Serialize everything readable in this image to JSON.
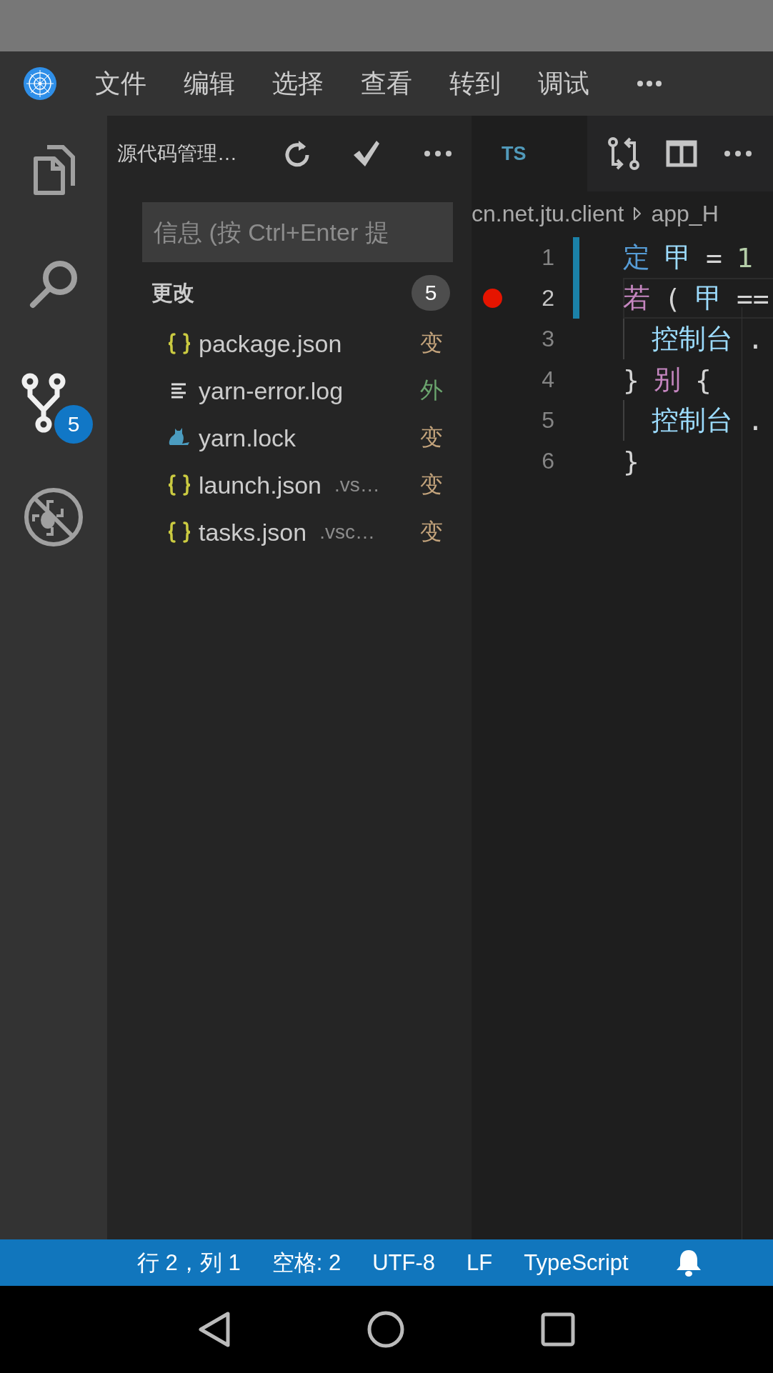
{
  "menu": {
    "items": [
      "文件",
      "编辑",
      "选择",
      "查看",
      "转到",
      "调试"
    ]
  },
  "activity_bar": [
    {
      "kind": "files",
      "selected": false
    },
    {
      "kind": "search",
      "selected": false
    },
    {
      "kind": "scm",
      "selected": true,
      "badge": "5"
    },
    {
      "kind": "debug",
      "selected": false
    }
  ],
  "sidebar": {
    "title": "源代码管理…",
    "message_input": {
      "placeholder": "信息 (按 Ctrl+Enter 提"
    },
    "changes": {
      "label": "更改",
      "count": "5",
      "files": [
        {
          "name": "package.json",
          "kind": "json",
          "status": "变",
          "color": "#c4a47c"
        },
        {
          "name": "yarn-error.log",
          "kind": "log",
          "status": "外",
          "color": "#6ba56e"
        },
        {
          "name": "yarn.lock",
          "kind": "yarn",
          "status": "变",
          "color": "#c4a47c"
        },
        {
          "name": "launch.json",
          "path": ".vs…",
          "kind": "json",
          "status": "变",
          "color": "#c4a47c"
        },
        {
          "name": "tasks.json",
          "path": ".vsc…",
          "kind": "json",
          "status": "变",
          "color": "#c4a47c"
        }
      ]
    }
  },
  "editor": {
    "tab": {
      "icon": "TS"
    },
    "breadcrumb": [
      "cn.net.jtu.client",
      "app_H"
    ],
    "lines": [
      {
        "number": "1",
        "breakpoint": false,
        "modified": true,
        "current": false,
        "indented": false,
        "tokens": [
          {
            "text": "定",
            "kind": "keyword"
          },
          {
            "text": "甲",
            "kind": "variable"
          },
          {
            "text": "=",
            "kind": "operator"
          },
          {
            "text": "1",
            "kind": "number"
          }
        ]
      },
      {
        "number": "2",
        "breakpoint": true,
        "modified": true,
        "current": true,
        "indented": false,
        "tokens": [
          {
            "text": "若",
            "kind": "control"
          },
          {
            "text": "(",
            "kind": "operator"
          },
          {
            "text": "甲",
            "kind": "variable"
          },
          {
            "text": "==",
            "kind": "operator"
          }
        ]
      },
      {
        "number": "3",
        "breakpoint": false,
        "modified": false,
        "current": false,
        "indented": true,
        "tokens": [
          {
            "text": "控制台",
            "kind": "variable"
          },
          {
            "text": ".",
            "kind": "operator"
          }
        ]
      },
      {
        "number": "4",
        "breakpoint": false,
        "modified": false,
        "current": false,
        "indented": false,
        "tokens": [
          {
            "text": "}",
            "kind": "operator"
          },
          {
            "text": "别",
            "kind": "control"
          },
          {
            "text": "{",
            "kind": "operator"
          }
        ]
      },
      {
        "number": "5",
        "breakpoint": false,
        "modified": false,
        "current": false,
        "indented": true,
        "tokens": [
          {
            "text": "控制台",
            "kind": "variable"
          },
          {
            "text": ".",
            "kind": "operator"
          }
        ]
      },
      {
        "number": "6",
        "breakpoint": false,
        "modified": false,
        "current": false,
        "indented": false,
        "tokens": [
          {
            "text": "}",
            "kind": "operator"
          }
        ]
      }
    ]
  },
  "status_bar": [
    "行 2，列 1",
    "空格: 2",
    "UTF-8",
    "LF",
    "TypeScript"
  ]
}
